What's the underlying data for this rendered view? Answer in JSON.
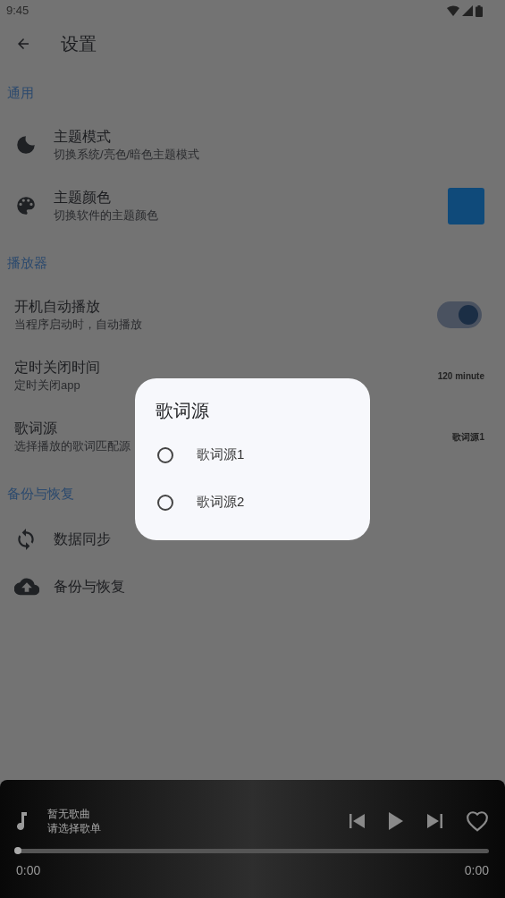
{
  "status_bar": {
    "time": "9:45"
  },
  "header": {
    "title": "设置"
  },
  "sections": [
    {
      "title": "通用",
      "items": [
        {
          "kind": "icon",
          "title": "主题模式",
          "subtitle": "切换系统/亮色/暗色主题模式"
        },
        {
          "kind": "color",
          "title": "主题颜色",
          "subtitle": "切换软件的主题颜色",
          "color": "#0f4a7a"
        }
      ]
    },
    {
      "title": "播放器",
      "items": [
        {
          "kind": "switch",
          "title": "开机自动播放",
          "subtitle": "当程序启动时，自动播放",
          "on": true
        },
        {
          "kind": "value",
          "title": "定时关闭时间",
          "subtitle": "定时关闭app",
          "value": "120 minute"
        },
        {
          "kind": "value",
          "title": "歌词源",
          "subtitle": "选择播放的歌词匹配源",
          "value": "歌词源1"
        }
      ]
    },
    {
      "title": "备份与恢复",
      "items": [
        {
          "kind": "icon",
          "title": "数据同步"
        },
        {
          "kind": "icon",
          "title": "备份与恢复"
        }
      ]
    }
  ],
  "dialog": {
    "title": "歌词源",
    "options": [
      {
        "label": "歌词源1",
        "selected": false
      },
      {
        "label": "歌词源2",
        "selected": false
      }
    ]
  },
  "player": {
    "title": "暂无歌曲",
    "subtitle": "请选择歌单",
    "level": 0,
    "elapsed": "0:00",
    "total": "0:00",
    "liked": false
  }
}
